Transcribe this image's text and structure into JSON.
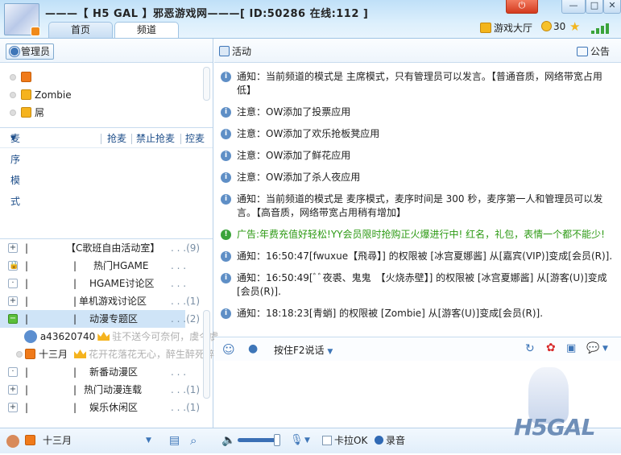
{
  "header": {
    "title": "———【 H5 GAL 】邪恶游戏网———[ ID:50286 在线:112 ]",
    "tabs": [
      {
        "label": "首页"
      },
      {
        "label": "频道"
      }
    ],
    "lobby": "游戏大厅",
    "coins": "30"
  },
  "left": {
    "admin_button": "管理员",
    "admins": [
      {
        "name": ""
      },
      {
        "name": "Zombie"
      },
      {
        "name": "屌"
      }
    ],
    "mic_mode": "麦序模式",
    "mic_actions": [
      "抢麦",
      "禁止抢麦",
      "控麦"
    ],
    "channels": [
      {
        "name": "【C歌班自由活动室】",
        "count": "(9)",
        "expand": "+"
      },
      {
        "name": "热门HGAME",
        "count": "",
        "expand": "🔒"
      },
      {
        "name": "HGAME讨论区",
        "count": "",
        "expand": "·"
      },
      {
        "name": "单机游戏讨论区",
        "count": "(1)",
        "expand": "+"
      },
      {
        "name": "动漫专题区",
        "count": "(2)",
        "expand": "−"
      },
      {
        "name": "新番动漫区",
        "count": "",
        "expand": "·"
      },
      {
        "name": "热门动漫连载",
        "count": "(1)",
        "expand": "+"
      },
      {
        "name": "娱乐休闲区",
        "count": "(1)",
        "expand": "+"
      }
    ],
    "channel_users": [
      {
        "name": "a43620740",
        "mood": "驻不送今可奈何，虞今虞"
      },
      {
        "name": "十三月",
        "mood": "花开花落花无心，醉生醉死醉"
      }
    ]
  },
  "right": {
    "activity": "活动",
    "notice": "公告",
    "messages": [
      {
        "type": "notice",
        "text": "通知：当前频道的模式是 主席模式，只有管理员可以发言。【普通音质，网络带宽占用低】"
      },
      {
        "type": "notice",
        "text": "注意：OW添加了投票应用"
      },
      {
        "type": "notice",
        "text": "注意：OW添加了欢乐抢板凳应用"
      },
      {
        "type": "notice",
        "text": "注意：OW添加了鲜花应用"
      },
      {
        "type": "notice",
        "text": "注意：OW添加了杀人夜应用"
      },
      {
        "type": "notice",
        "text": "通知：当前频道的模式是 麦序模式，麦序时间是 300 秒，麦序第一人和管理员可以发言。【高音质，网络带宽占用稍有增加】"
      },
      {
        "type": "ad",
        "text": "广告:年费充值好轻松!YY会员限时抢购正火爆进行中! 红名，礼包，表情一个都不能少!"
      },
      {
        "type": "notice",
        "text": "通知：16:50:47[fwuxue【飛尋】] 的权限被 [冰宫夏娜酱] 从[嘉宾(VIP)]变成[会员(R)]."
      },
      {
        "type": "notice",
        "text": "通知：16:50:49[ﾞﾞ夜裘、鬼鬼　【火烧赤壁】] 的权限被 [冰宫夏娜酱] 从[游客(U)]变成[会员(R)]."
      },
      {
        "type": "notice",
        "text": "通知：18:18:23[青蛸] 的权限被 [Zombie] 从[游客(U)]变成[会员(R)]."
      }
    ],
    "speak_mode": "按住F2说话"
  },
  "status": {
    "user": "十三月",
    "karaoke": "卡拉OK",
    "record": "录音"
  },
  "logo_text": "H5GAL"
}
